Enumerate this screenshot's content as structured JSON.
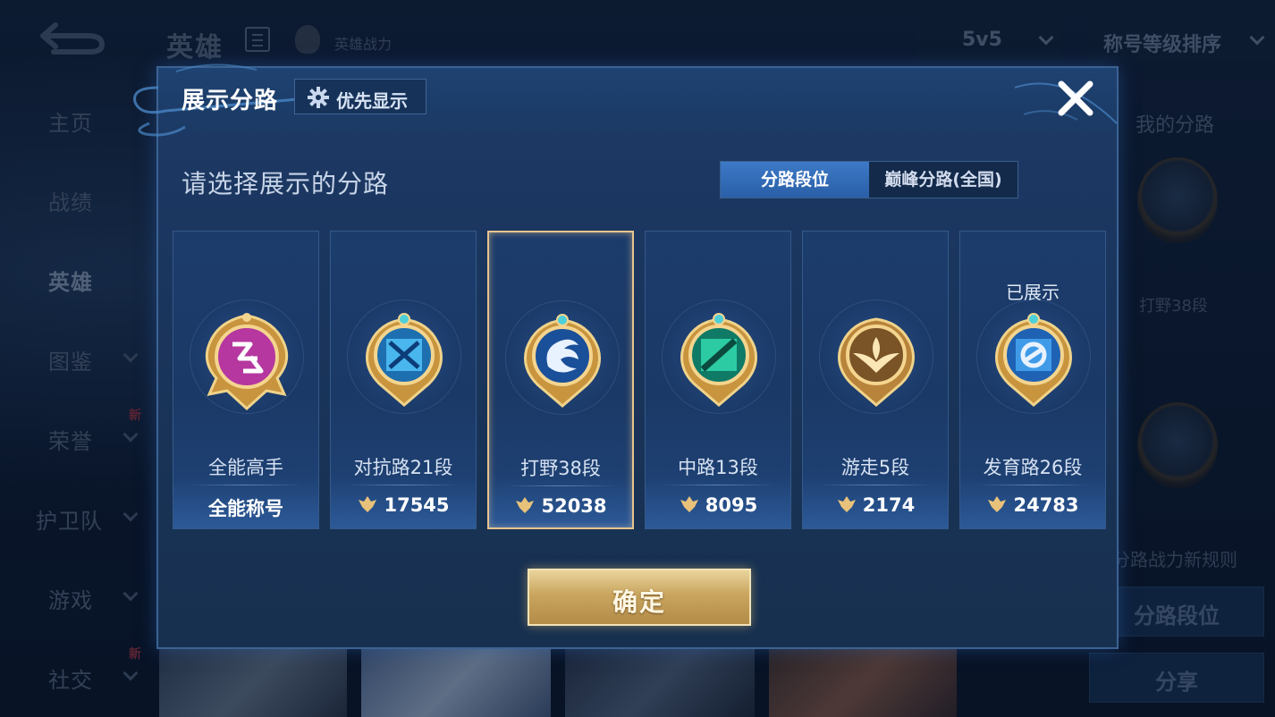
{
  "background": {
    "top_title": "英雄",
    "hero_power_label": "英雄战力",
    "mode_select": "5v5",
    "sort_select": "称号等级排序",
    "sidebar": [
      {
        "label": "主页",
        "new": false,
        "chevron": false
      },
      {
        "label": "战绩",
        "new": false,
        "chevron": false
      },
      {
        "label": "英雄",
        "new": false,
        "chevron": false,
        "active": true
      },
      {
        "label": "图鉴",
        "new": false,
        "chevron": true
      },
      {
        "label": "荣誉",
        "new": true,
        "chevron": true
      },
      {
        "label": "护卫队",
        "new": false,
        "chevron": true
      },
      {
        "label": "游戏",
        "new": false,
        "chevron": true
      },
      {
        "label": "社交",
        "new": true,
        "chevron": true
      }
    ],
    "new_badge": "新",
    "right_panel": {
      "title": "我的分路",
      "lane": "打野38段",
      "rules_link": "分路战力新规则",
      "lane_rank_button": "分路段位",
      "share_button": "分享"
    }
  },
  "modal": {
    "title": "展示分路",
    "priority_button": "优先显示",
    "prompt": "请选择展示的分路",
    "tabs": [
      "分路段位",
      "巅峰分路(全国)"
    ],
    "active_tab": 0,
    "shown_tag": "已展示",
    "cards": [
      {
        "name": "全能高手",
        "stat": "全能称号",
        "has_power": false,
        "emblem": "all-round-emblem",
        "color": "#c23fb8",
        "selected": false,
        "shown": false
      },
      {
        "name": "对抗路21段",
        "stat": "17545",
        "has_power": true,
        "emblem": "clash-lane-emblem",
        "color": "#2e9fe0",
        "selected": false,
        "shown": false
      },
      {
        "name": "打野38段",
        "stat": "52038",
        "has_power": true,
        "emblem": "jungle-emblem",
        "color": "#2a6fc8",
        "selected": true,
        "shown": false
      },
      {
        "name": "中路13段",
        "stat": "8095",
        "has_power": true,
        "emblem": "mid-lane-emblem",
        "color": "#1fae8e",
        "selected": false,
        "shown": false
      },
      {
        "name": "游走5段",
        "stat": "2174",
        "has_power": true,
        "emblem": "roam-emblem",
        "color": "#c99a4e",
        "selected": false,
        "shown": false
      },
      {
        "name": "发育路26段",
        "stat": "24783",
        "has_power": true,
        "emblem": "farm-lane-emblem",
        "color": "#3b8fe0",
        "selected": false,
        "shown": true
      }
    ],
    "confirm_button": "确定"
  }
}
